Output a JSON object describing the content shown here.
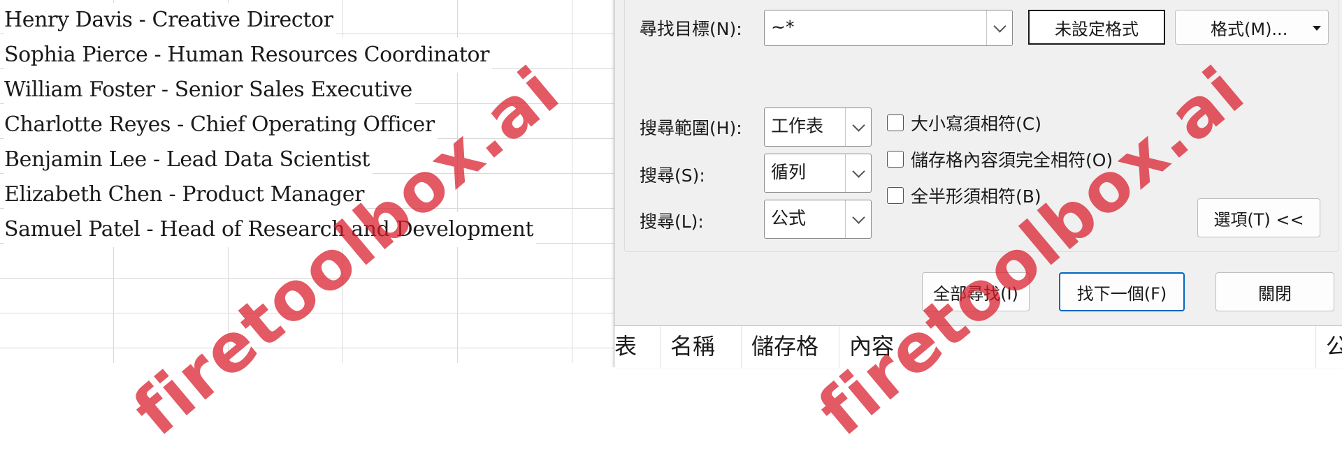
{
  "spreadsheet": {
    "rows": [
      "Henry Davis - Creative Director",
      "Sophia Pierce - Human Resources Coordinator",
      "William Foster - Senior Sales Executive",
      "Charlotte Reyes - Chief Operating Officer",
      "Benjamin Lee - Lead Data Scientist",
      "Elizabeth Chen - Product Manager",
      "Samuel Patel - Head of Research and Development"
    ]
  },
  "dialog": {
    "find_what_label": "尋找目標(N):",
    "find_what_value": "~*",
    "no_format_label": "未設定格式",
    "format_button": "格式(M)...",
    "within_label": "搜尋範圍(H):",
    "within_value": "工作表",
    "search_label": "搜尋(S):",
    "search_value": "循列",
    "look_in_label": "搜尋(L):",
    "look_in_value": "公式",
    "match_case": "大小寫須相符(C)",
    "match_entire": "儲存格內容須完全相符(O)",
    "match_byte": "全半形須相符(B)",
    "options_button": "選項(T) <<",
    "find_all": "全部尋找(I)",
    "find_next": "找下一個(F)",
    "close": "關閉",
    "results_columns": [
      "表",
      "名稱",
      "儲存格",
      "內容",
      "公式"
    ]
  },
  "watermark": {
    "text_left": "firetoolbox.ai",
    "text_right": "firetoolbox.ai"
  },
  "colors": {
    "watermark": "#d81a28",
    "default_button_border": "#0067c0",
    "dialog_bg": "#f0f0f0"
  }
}
